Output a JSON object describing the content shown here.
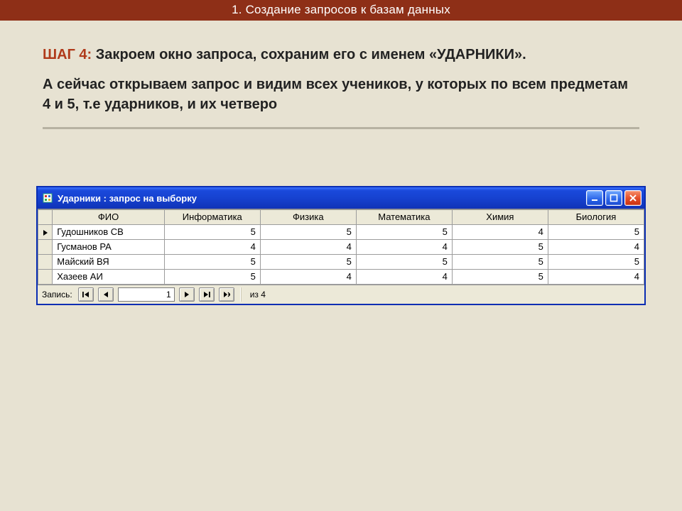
{
  "slide": {
    "title": "1. Создание запросов к базам данных",
    "step_tag": "ШАГ 4:",
    "step_title": "Закроем окно запроса, сохраним его с именем «УДАРНИКИ».",
    "paragraph": " А сейчас открываем запрос и видим всех учеников, у которых по всем предметам 4 и 5, т.е ударников, и их четверо"
  },
  "window": {
    "title": "Ударники : запрос на выборку"
  },
  "grid": {
    "columns": [
      "ФИО",
      "Информатика",
      "Физика",
      "Математика",
      "Химия",
      "Биология"
    ],
    "rows": [
      {
        "name": "Гудошников СВ",
        "vals": [
          5,
          5,
          5,
          4,
          5
        ]
      },
      {
        "name": "Гусманов РА",
        "vals": [
          4,
          4,
          4,
          5,
          4
        ]
      },
      {
        "name": "Майский ВЯ",
        "vals": [
          5,
          5,
          5,
          5,
          5
        ]
      },
      {
        "name": "Хазеев АИ",
        "vals": [
          5,
          4,
          4,
          5,
          4
        ]
      }
    ]
  },
  "recnav": {
    "label": "Запись:",
    "current": "1",
    "of": "из 4"
  }
}
